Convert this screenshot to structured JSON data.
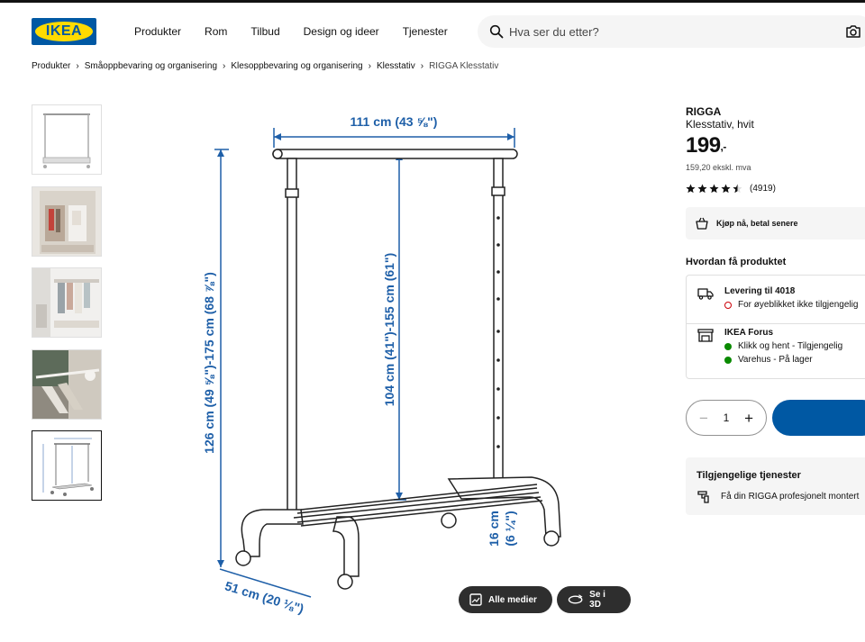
{
  "brand": {
    "logo_text": "IKEA",
    "blue": "#0058a3",
    "yellow": "#ffdb00"
  },
  "nav": [
    "Produkter",
    "Rom",
    "Tilbud",
    "Design og ideer",
    "Tjenester"
  ],
  "search": {
    "placeholder": "Hva ser du etter?",
    "icon": "search-icon",
    "camera_icon": "camera-icon"
  },
  "breadcrumb": {
    "items": [
      "Produkter",
      "Småoppbevaring og organisering",
      "Klesoppbevaring og organisering",
      "Klesstativ"
    ],
    "current": "RIGGA Klesstativ"
  },
  "gallery": {
    "thumbnail_count": 5,
    "active_index": 4,
    "dimensions": {
      "width_label": "111 cm (43 ⅝\")",
      "total_height_label": "126 cm (49 ⅝\")-175 cm (68 ⅞\")",
      "rail_height_label": "104 cm (41\")-155 cm (61\")",
      "depth_label": "51 cm (20 ⅛\")",
      "shelf_height_label_1": "16 cm",
      "shelf_height_label_2": "(6 ¼\")"
    },
    "buttons": {
      "all_media": "Alle medier",
      "view_3d": "Se i 3D"
    }
  },
  "product": {
    "name": "RIGGA",
    "description": "Klesstativ, hvit",
    "price": "199",
    "price_suffix": ",-",
    "vat_text": "159,20 ekskl. mva",
    "rating": 4.5,
    "review_count": "(4919)"
  },
  "payment": {
    "label": "Kjøp nå, betal senere"
  },
  "availability": {
    "title": "Hvordan få produktet",
    "delivery": {
      "title": "Levering til 4018",
      "status": "For øyeblikket ikke tilgjengelig"
    },
    "store": {
      "title": "IKEA Forus",
      "line1": "Klikk og hent - Tilgjengelig",
      "line2": "Varehus - På lager"
    }
  },
  "quantity": {
    "value": "1",
    "minus": "−",
    "plus": "+"
  },
  "services": {
    "title": "Tilgjengelige tjenester",
    "item": "Få din RIGGA profesjonelt montert"
  }
}
